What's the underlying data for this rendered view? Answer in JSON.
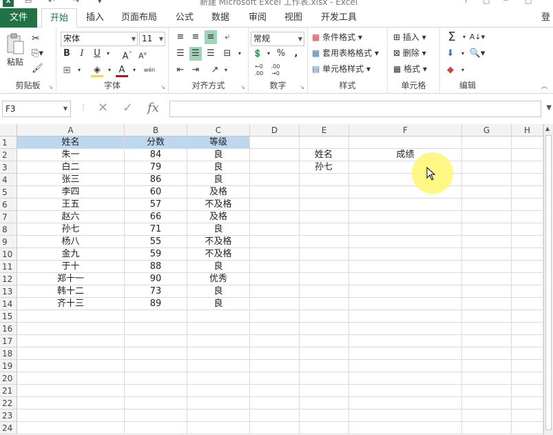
{
  "titlebar": {
    "title": "新建 Microsoft Excel 工作表.xlsx - Excel",
    "app_icon": "excel-logo",
    "win_buttons": [
      "?",
      "▢",
      "─",
      "▢"
    ]
  },
  "tabs": [
    {
      "id": "file",
      "label": "文件"
    },
    {
      "id": "home",
      "label": "开始"
    },
    {
      "id": "insert",
      "label": "插入"
    },
    {
      "id": "layout",
      "label": "页面布局"
    },
    {
      "id": "formulas",
      "label": "公式"
    },
    {
      "id": "data",
      "label": "数据"
    },
    {
      "id": "review",
      "label": "审阅"
    },
    {
      "id": "view",
      "label": "视图"
    },
    {
      "id": "developer",
      "label": "开发工具"
    }
  ],
  "login": "登",
  "ribbon": {
    "clipboard": {
      "label": "剪贴板",
      "paste": "粘贴"
    },
    "font": {
      "label": "字体",
      "name": "宋体",
      "size": "11",
      "wen": "wén"
    },
    "alignment": {
      "label": "对齐方式"
    },
    "number": {
      "label": "数字",
      "format": "常规"
    },
    "styles": {
      "label": "样式",
      "conditional": "条件格式",
      "table": "套用表格格式",
      "cell_styles": "单元格样式"
    },
    "cells": {
      "label": "单元格",
      "insert": "插入",
      "delete": "删除",
      "format": "格式"
    },
    "editing": {
      "label": "编辑"
    }
  },
  "formula_bar": {
    "name_box": "F3",
    "formula": ""
  },
  "columns": [
    "A",
    "B",
    "C",
    "D",
    "E",
    "F",
    "G",
    "H"
  ],
  "rows": [
    "1",
    "2",
    "3",
    "4",
    "5",
    "6",
    "7",
    "8",
    "9",
    "10",
    "11",
    "12",
    "13",
    "14",
    "15",
    "16",
    "17",
    "18",
    "19",
    "20",
    "21",
    "22",
    "23",
    "24"
  ],
  "table": {
    "headers": [
      "姓名",
      "分数",
      "等级"
    ],
    "records": [
      [
        "朱一",
        "84",
        "良"
      ],
      [
        "白二",
        "79",
        "良"
      ],
      [
        "张三",
        "86",
        "良"
      ],
      [
        "李四",
        "60",
        "及格"
      ],
      [
        "王五",
        "57",
        "不及格"
      ],
      [
        "赵六",
        "66",
        "及格"
      ],
      [
        "孙七",
        "71",
        "良"
      ],
      [
        "杨八",
        "55",
        "不及格"
      ],
      [
        "金九",
        "59",
        "不及格"
      ],
      [
        "于十",
        "88",
        "良"
      ],
      [
        "郑十一",
        "90",
        "优秀"
      ],
      [
        "韩十二",
        "73",
        "良"
      ],
      [
        "齐十三",
        "89",
        "良"
      ]
    ]
  },
  "lookup": {
    "e2": "姓名",
    "f2": "成绩",
    "e3": "孙七"
  },
  "colors": {
    "excel_green": "#217346",
    "header_fill": "#bdd7ee",
    "cursor_highlight": "#fff76e"
  }
}
